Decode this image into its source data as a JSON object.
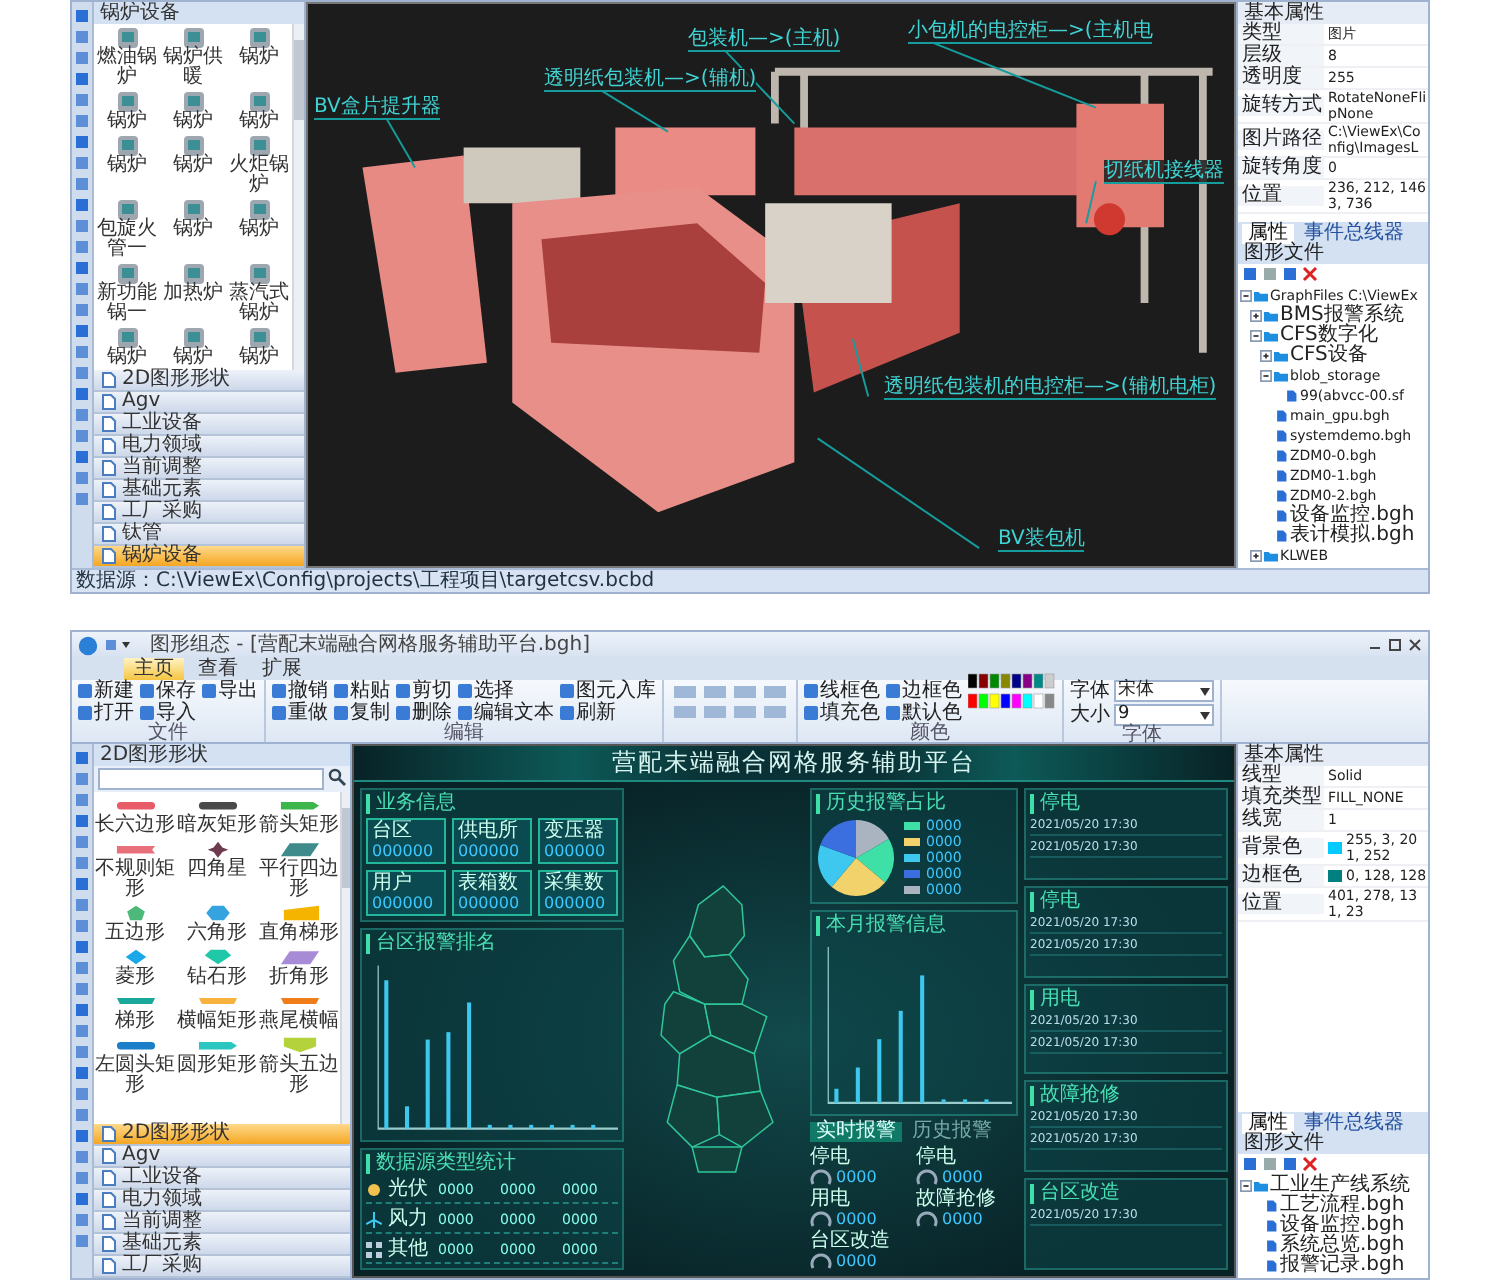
{
  "top_window": {
    "palette": {
      "title": "锅炉设备",
      "items": [
        "燃油锅炉",
        "锅炉供暖",
        "锅炉",
        "锅炉",
        "锅炉",
        "锅炉",
        "锅炉",
        "锅炉",
        "火炬锅炉",
        "包旋火管一",
        "锅炉",
        "锅炉",
        "新功能锅一",
        "加热炉",
        "蒸汽式锅炉",
        "锅炉",
        "锅炉",
        "锅炉"
      ],
      "categories": [
        {
          "label": "2D图形形状",
          "selected": false
        },
        {
          "label": "Agv",
          "selected": false
        },
        {
          "label": "工业设备",
          "selected": false
        },
        {
          "label": "电力领域",
          "selected": false
        },
        {
          "label": "当前调整",
          "selected": false
        },
        {
          "label": "基础元素",
          "selected": false
        },
        {
          "label": "工厂采购",
          "selected": false
        },
        {
          "label": "钛管",
          "selected": false
        },
        {
          "label": "锅炉设备",
          "selected": true
        }
      ]
    },
    "canvas": {
      "callouts": [
        "BV盒片提升器",
        "透明纸包装机—>(辅机)",
        "包装机—>(主机)",
        "小包机的电控柜—>(主机电",
        "切纸机接线器",
        "透明纸包装机的电控柜—>(辅机电柜)",
        "BV装包机"
      ]
    },
    "status_bar": {
      "text": "数据源：C:\\ViewEx\\Config\\projects\\工程项目\\targetcsv.bcbd"
    },
    "properties": {
      "section": "基本属性",
      "rows": [
        {
          "label": "类型",
          "value": "图片"
        },
        {
          "label": "层级",
          "value": "8"
        },
        {
          "label": "透明度",
          "value": "255"
        },
        {
          "label": "旋转方式",
          "value": "RotateNoneFlipNone"
        },
        {
          "label": "图片路径",
          "value": "C:\\ViewEx\\Config\\ImagesL"
        },
        {
          "label": "旋转角度",
          "value": "0"
        },
        {
          "label": "位置",
          "value": "236, 212, 1463, 736"
        }
      ],
      "tabs": [
        {
          "label": "属性",
          "selected": true
        },
        {
          "label": "事件总线器",
          "selected": false
        }
      ]
    },
    "file_tree": {
      "title": "图形文件",
      "items": [
        {
          "label": "GraphFiles C:\\ViewEx",
          "expanded": true,
          "children": [
            {
              "label": "BMS报警系统",
              "expanded": false
            },
            {
              "label": "CFS数字化",
              "expanded": true,
              "children": [
                {
                  "label": "CFS设备",
                  "expanded": false
                },
                {
                  "label": "blob_storage",
                  "expanded": true,
                  "children": [
                    {
                      "label": "99(abvcc-00.sf"
                    }
                  ]
                },
                {
                  "label": "main_gpu.bgh"
                },
                {
                  "label": "systemdemo.bgh"
                },
                {
                  "label": "ZDM0-0.bgh"
                },
                {
                  "label": "ZDM0-1.bgh"
                },
                {
                  "label": "ZDM0-2.bgh"
                },
                {
                  "label": "设备监控.bgh"
                },
                {
                  "label": "表计模拟.bgh"
                }
              ]
            },
            {
              "label": "KLWEB",
              "expanded": false
            }
          ]
        }
      ]
    }
  },
  "bottom_window": {
    "title": "图形组态 - [营配末端融合网格服务辅助平台.bgh]",
    "tabs": [
      {
        "label": "主页",
        "selected": true
      },
      {
        "label": "查看",
        "selected": false
      },
      {
        "label": "扩展",
        "selected": false
      }
    ],
    "ribbon_groups": [
      {
        "label": "文件",
        "buttons": [
          "新建",
          "打开",
          "保存",
          "导入",
          "导出"
        ]
      },
      {
        "label": "编辑",
        "buttons": [
          "撤销",
          "重做",
          "粘贴",
          "复制",
          "剪切",
          "删除",
          "选择",
          "编辑文本",
          "图元入库",
          "刷新"
        ]
      },
      {
        "label": "颜色",
        "buttons": [
          "线框色",
          "填充色",
          "边框色",
          "默认色"
        ]
      }
    ],
    "font_group": {
      "label": "字体",
      "fields": [
        {
          "label": "字体",
          "value": "宋体"
        },
        {
          "label": "大小",
          "value": "9"
        }
      ]
    },
    "palette": {
      "title": "2D图形形状",
      "items": [
        {
          "label": "长六边形",
          "kind": "bar",
          "color": "#e85c6a"
        },
        {
          "label": "暗灰矩形",
          "kind": "bar",
          "color": "#4a4a4a"
        },
        {
          "label": "箭头矩形",
          "kind": "arrow",
          "color": "#3cb54a"
        },
        {
          "label": "不规则矩形",
          "kind": "flag",
          "color": "#e8707a"
        },
        {
          "label": "四角星",
          "kind": "star",
          "color": "#6e3a4e"
        },
        {
          "label": "平行四边形",
          "kind": "parallelogram",
          "color": "#3f8a8a"
        },
        {
          "label": "五边形",
          "kind": "pentagon",
          "color": "#4cb87a"
        },
        {
          "label": "六角形",
          "kind": "hexagon",
          "color": "#34a3e0"
        },
        {
          "label": "直角梯形",
          "kind": "trapezoid",
          "color": "#f5b400"
        },
        {
          "label": "菱形",
          "kind": "diamond",
          "color": "#1aa8e8"
        },
        {
          "label": "钻石形",
          "kind": "gem",
          "color": "#1fc8a8"
        },
        {
          "label": "折角形",
          "kind": "parallelogram",
          "color": "#a78bd6"
        },
        {
          "label": "梯形",
          "kind": "ribbon",
          "color": "#1aa89a"
        },
        {
          "label": "横幅矩形",
          "kind": "ribbon",
          "color": "#f6b23c"
        },
        {
          "label": "燕尾横幅",
          "kind": "ribbon",
          "color": "#ef7d1a"
        },
        {
          "label": "左圆头矩形",
          "kind": "bar",
          "color": "#1a7fc8"
        },
        {
          "label": "圆形矩形",
          "kind": "arrow",
          "color": "#2cc6c0"
        },
        {
          "label": "箭头五边形",
          "kind": "chevron",
          "color": "#b4d23c"
        }
      ],
      "categories": [
        {
          "label": "2D图形形状",
          "selected": true
        },
        {
          "label": "Agv",
          "selected": false
        },
        {
          "label": "工业设备",
          "selected": false
        },
        {
          "label": "电力领域",
          "selected": false
        },
        {
          "label": "当前调整",
          "selected": false
        },
        {
          "label": "基础元素",
          "selected": false
        },
        {
          "label": "工厂采购",
          "selected": false
        }
      ]
    },
    "dashboard": {
      "title": "营配末端融合网格服务辅助平台",
      "business": {
        "title": "业务信息",
        "cards": [
          {
            "label": "台区",
            "value": "000000"
          },
          {
            "label": "供电所",
            "value": "000000"
          },
          {
            "label": "变压器",
            "value": "000000"
          },
          {
            "label": "用户",
            "value": "000000"
          },
          {
            "label": "表箱数",
            "value": "000000"
          },
          {
            "label": "采集数",
            "value": "000000"
          }
        ]
      },
      "ranking": {
        "title": "台区报警排名"
      },
      "sources": {
        "title": "数据源类型统计",
        "rows": [
          {
            "kind": "solar",
            "label": "光伏",
            "values": [
              "0000",
              "0000",
              "0000"
            ]
          },
          {
            "kind": "wind",
            "label": "风力",
            "values": [
              "0000",
              "0000",
              "0000"
            ]
          },
          {
            "kind": "other",
            "label": "其他",
            "values": [
              "0000",
              "0000",
              "0000"
            ]
          }
        ]
      },
      "history": {
        "title": "历史报警占比",
        "legend": [
          {
            "color": "#3fe0a8",
            "value": "0000"
          },
          {
            "color": "#f2d36b",
            "value": "0000"
          },
          {
            "color": "#3ec8f0",
            "value": "0000"
          },
          {
            "color": "#3b6fe0",
            "value": "0000"
          },
          {
            "color": "#aab4c0",
            "value": "0000"
          }
        ]
      },
      "monthly": {
        "title": "本月报警信息"
      },
      "tabs": [
        {
          "label": "实时报警",
          "selected": true
        },
        {
          "label": "历史报警",
          "selected": false
        }
      ],
      "gauges": [
        {
          "label": "停电",
          "value": "0000"
        },
        {
          "label": "停电",
          "value": "0000"
        },
        {
          "label": "用电",
          "value": "0000"
        },
        {
          "label": "故障抢修",
          "value": "0000"
        },
        {
          "label": "台区改造",
          "value": "0000"
        }
      ],
      "lists": [
        {
          "title": "停电",
          "rows": [
            "2021/05/20 17:30",
            "2021/05/20 17:30"
          ]
        },
        {
          "title": "停电",
          "rows": [
            "2021/05/20 17:30",
            "2021/05/20 17:30"
          ]
        },
        {
          "title": "用电",
          "rows": [
            "2021/05/20 17:30",
            "2021/05/20 17:30"
          ]
        },
        {
          "title": "故障抢修",
          "rows": [
            "2021/05/20 17:30",
            "2021/05/20 17:30"
          ]
        },
        {
          "title": "台区改造",
          "rows": [
            "2021/05/20 17:30"
          ]
        }
      ]
    },
    "properties": {
      "section": "基本属性",
      "rows": [
        {
          "label": "线型",
          "value": "Solid"
        },
        {
          "label": "填充类型",
          "value": "FILL_NONE"
        },
        {
          "label": "线宽",
          "value": "1"
        },
        {
          "label": "背景色",
          "value": "255, 3, 201, 252",
          "color": "#03c9fc"
        },
        {
          "label": "边框色",
          "value": "0, 128, 128",
          "color": "#008080"
        },
        {
          "label": "位置",
          "value": "401, 278, 131, 23"
        }
      ],
      "tabs": [
        {
          "label": "属性",
          "selected": true
        },
        {
          "label": "事件总线器",
          "selected": false
        }
      ]
    },
    "file_tree": {
      "title": "图形文件",
      "items": [
        {
          "label": "工业生产线系统",
          "expanded": true,
          "children": [
            {
              "label": "工艺流程.bgh"
            },
            {
              "label": "设备监控.bgh"
            },
            {
              "label": "系统总览.bgh"
            },
            {
              "label": "报警记录.bgh"
            }
          ]
        }
      ]
    }
  }
}
